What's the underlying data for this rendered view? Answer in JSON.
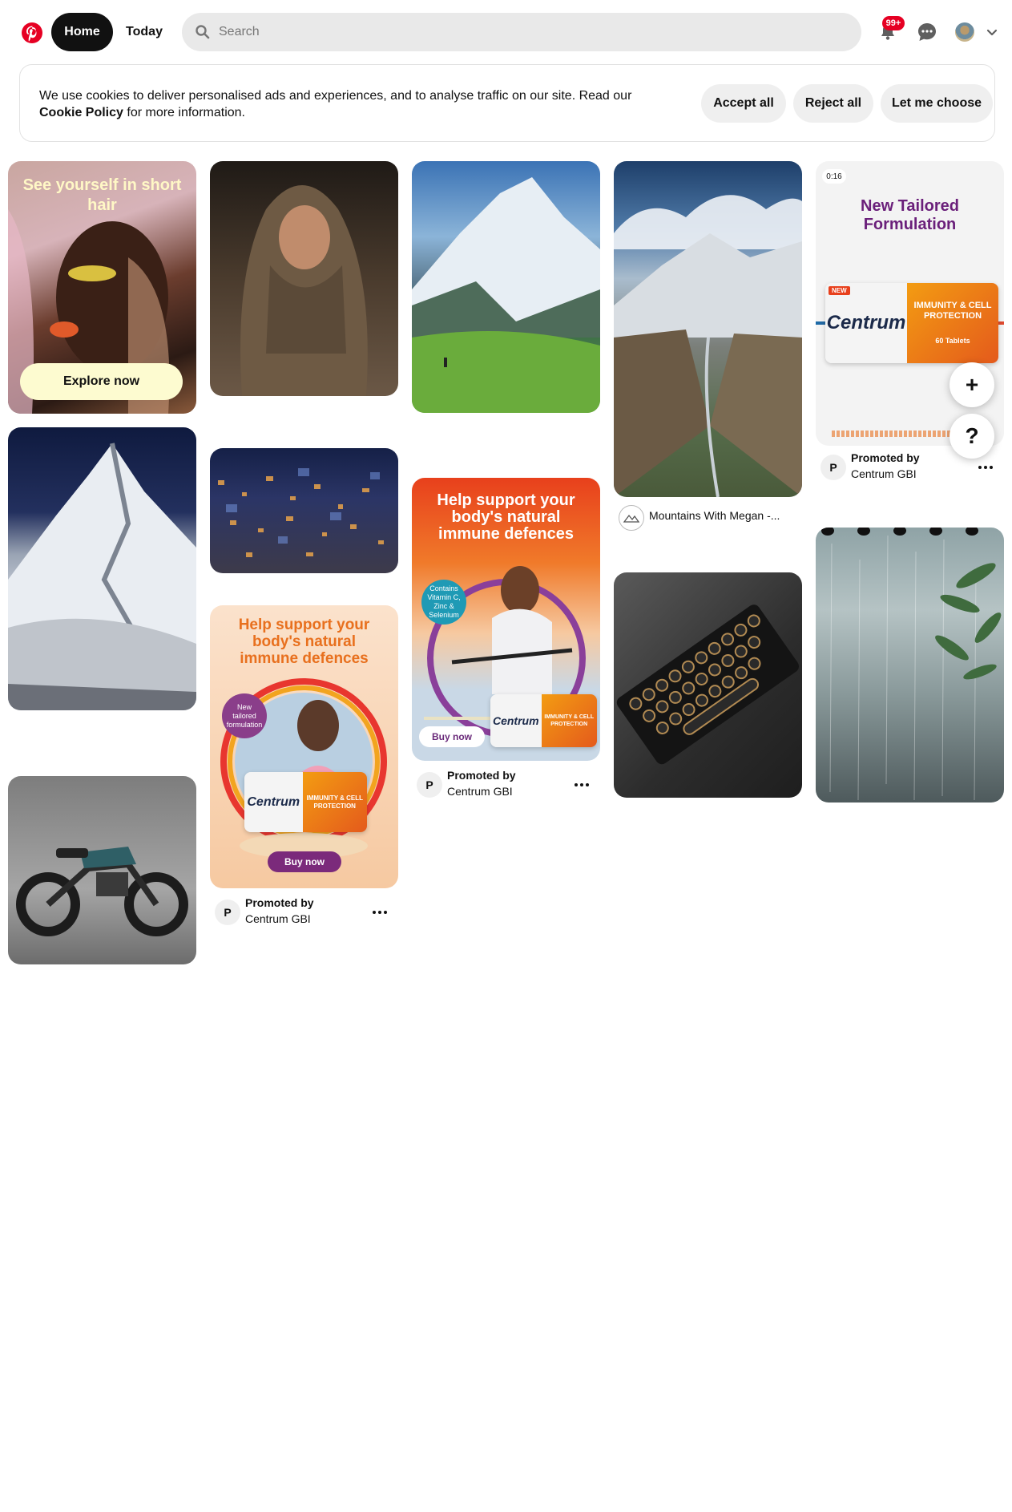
{
  "header": {
    "logo_icon": "pinterest-logo-icon",
    "nav_home": "Home",
    "nav_today": "Today",
    "search_placeholder": "Search",
    "notifications_badge": "99+",
    "brand_color": "#e60023"
  },
  "cookie_banner": {
    "text_before": "We use cookies to deliver personalised ads and experiences, and to analyse traffic on our site. Read our",
    "policy_link": "Cookie Policy",
    "text_after": "for more information.",
    "accept_all": "Accept all",
    "reject_all": "Reject all",
    "let_me_choose": "Let me choose"
  },
  "pins": {
    "short_hair": {
      "headline": "See yourself in short hair",
      "cta": "Explore now"
    },
    "centrum_ad_col2": {
      "headline": "Help support your body's natural immune defences",
      "badge": "New tailored formulation",
      "cta": "Buy now",
      "promoted_by": "Promoted by",
      "advertiser": "Centrum GBI",
      "avatar_letter": "P"
    },
    "centrum_ad_col3": {
      "headline": "Help support your body's natural immune defences",
      "badge": "Contains Vitamin C, Zinc & Selenium",
      "cta": "Buy now",
      "promoted_by": "Promoted by",
      "advertiser": "Centrum GBI",
      "avatar_letter": "P"
    },
    "mountains_megan": {
      "source": "Mountains With Megan -..."
    },
    "centrum_video_col5": {
      "duration": "0:16",
      "headline": "New Tailored Formulation",
      "brand": "Centrum",
      "product_line": "IMMUNITY & CELL PROTECTION",
      "count": "60 Tablets",
      "new_tag": "NEW",
      "promoted_by": "Promoted by",
      "advertiser": "Centrum GBI",
      "avatar_letter": "P"
    }
  },
  "product_box": {
    "brand": "Centrum",
    "line": "IMMUNITY & CELL PROTECTION"
  },
  "floating": {
    "plus": "+",
    "help": "?"
  }
}
